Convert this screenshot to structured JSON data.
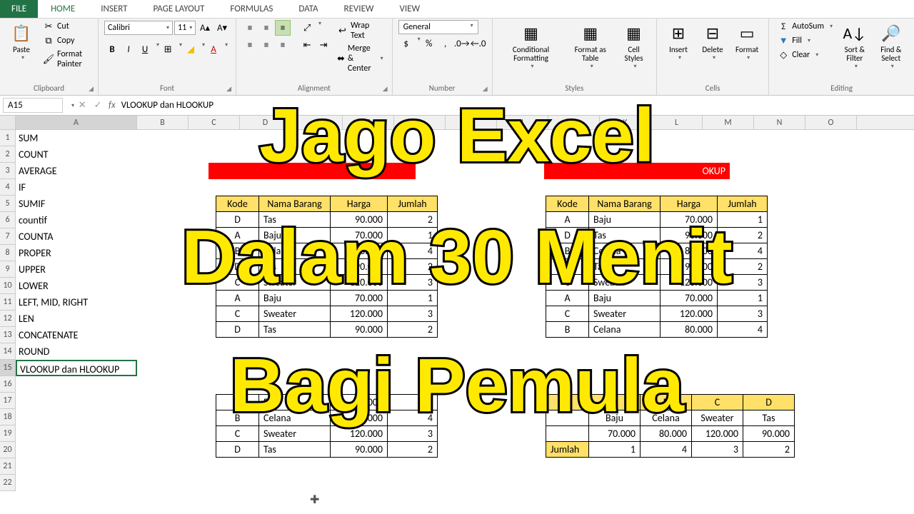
{
  "tabs": {
    "file": "FILE",
    "items": [
      "HOME",
      "INSERT",
      "PAGE LAYOUT",
      "FORMULAS",
      "DATA",
      "REVIEW",
      "VIEW"
    ],
    "active": 0
  },
  "ribbon": {
    "clipboard": {
      "paste": "Paste",
      "cut": "Cut",
      "copy": "Copy",
      "fp": "Format Painter",
      "label": "Clipboard"
    },
    "font": {
      "name": "Calibri",
      "size": "11",
      "label": "Font"
    },
    "alignment": {
      "wrap": "Wrap Text",
      "merge": "Merge & Center",
      "label": "Alignment"
    },
    "number": {
      "format": "General",
      "label": "Number"
    },
    "styles": {
      "cf": "Conditional Formatting",
      "fat": "Format as Table",
      "cs": "Cell Styles",
      "label": "Styles"
    },
    "cells": {
      "ins": "Insert",
      "del": "Delete",
      "fmt": "Format",
      "label": "Cells"
    },
    "editing": {
      "autosum": "AutoSum",
      "fill": "Fill",
      "clear": "Clear",
      "sort": "Sort & Filter",
      "find": "Find & Select",
      "label": "Editing"
    }
  },
  "formula_bar": {
    "name_box": "A15",
    "formula": "VLOOKUP dan HLOOKUP"
  },
  "columns": [
    "A",
    "B",
    "C",
    "D",
    "E",
    "F",
    "G",
    "H",
    "I",
    "J",
    "K",
    "L",
    "M",
    "N",
    "O"
  ],
  "rows": [
    "1",
    "2",
    "3",
    "4",
    "5",
    "6",
    "7",
    "8",
    "9",
    "10",
    "11",
    "12",
    "13",
    "14",
    "15",
    "16",
    "17",
    "18",
    "19",
    "20",
    "21",
    "22"
  ],
  "colA": [
    "SUM",
    "COUNT",
    "AVERAGE",
    "IF",
    "SUMIF",
    "countif",
    "COUNTA",
    "PROPER",
    "UPPER",
    "LOWER",
    "LEFT, MID, RIGHT",
    "LEN",
    "CONCATENATE",
    "ROUND",
    "VLOOKUP dan HLOOKUP"
  ],
  "table1": {
    "headers": [
      "Kode",
      "Nama Barang",
      "Harga",
      "Jumlah"
    ],
    "rows": [
      [
        "D",
        "Tas",
        "90.000",
        "2"
      ],
      [
        "A",
        "Baju",
        "70.000",
        "1"
      ],
      [
        "B",
        "Celana",
        "80.000",
        "4"
      ],
      [
        "D",
        "Tas",
        "90.000",
        "2"
      ],
      [
        "C",
        "Sweater",
        "120.000",
        "3"
      ],
      [
        "A",
        "Baju",
        "70.000",
        "1"
      ],
      [
        "C",
        "Sweater",
        "120.000",
        "3"
      ],
      [
        "D",
        "Tas",
        "90.000",
        "2"
      ]
    ]
  },
  "table2": {
    "headers": [
      "Kode",
      "Nama Barang",
      "Harga",
      "Jumlah"
    ],
    "rows": [
      [
        "A",
        "Baju",
        "70.000",
        "1"
      ],
      [
        "D",
        "Tas",
        "90.000",
        "2"
      ],
      [
        "B",
        "Celana",
        "80.000",
        "4"
      ],
      [
        "D",
        "Tas",
        "90.000",
        "2"
      ],
      [
        "C",
        "Sweater",
        "120.000",
        "3"
      ],
      [
        "A",
        "Baju",
        "70.000",
        "1"
      ],
      [
        "C",
        "Sweater",
        "120.000",
        "3"
      ],
      [
        "B",
        "Celana",
        "80.000",
        "4"
      ]
    ]
  },
  "table3": {
    "rows": [
      [
        "A",
        "Baju",
        "70.000",
        "1"
      ],
      [
        "B",
        "Celana",
        "80.000",
        "4"
      ],
      [
        "C",
        "Sweater",
        "120.000",
        "3"
      ],
      [
        "D",
        "Tas",
        "90.000",
        "2"
      ]
    ]
  },
  "hlookup": {
    "cols": [
      "A",
      "B",
      "C",
      "D"
    ],
    "nama": [
      "Baju",
      "Celana",
      "Sweater",
      "Tas"
    ],
    "harga": [
      "70.000",
      "80.000",
      "120.000",
      "90.000"
    ],
    "jumlah": [
      "1",
      "4",
      "3",
      "2"
    ],
    "jumlah_label": "Jumlah"
  },
  "overlay": {
    "l1": "Jago Excel",
    "l2": "Dalam 30 Menit",
    "l3": "Bagi Pemula"
  },
  "banner_text": "OKUP"
}
